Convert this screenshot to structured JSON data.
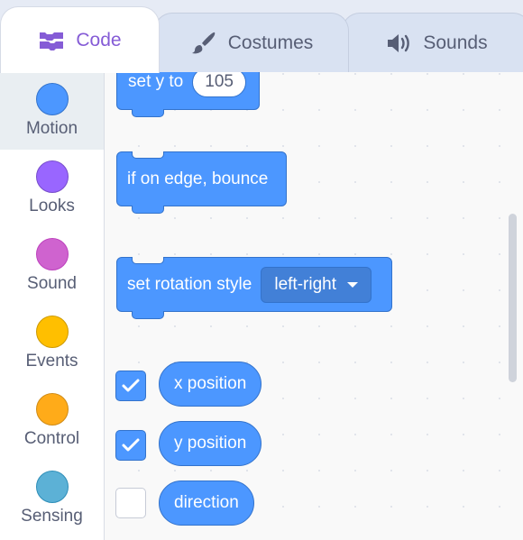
{
  "tabs": {
    "code": "Code",
    "costumes": "Costumes",
    "sounds": "Sounds"
  },
  "categories": [
    {
      "label": "Motion",
      "color": "#4c97ff",
      "border": "#3373cc"
    },
    {
      "label": "Looks",
      "color": "#9966ff",
      "border": "#774dcb"
    },
    {
      "label": "Sound",
      "color": "#cf63cf",
      "border": "#bd42bd"
    },
    {
      "label": "Events",
      "color": "#ffbf00",
      "border": "#cc9900"
    },
    {
      "label": "Control",
      "color": "#ffab19",
      "border": "#cf8b17"
    },
    {
      "label": "Sensing",
      "color": "#5cb1d6",
      "border": "#2e8eb8"
    }
  ],
  "blocks": {
    "set_y": {
      "label": "set y to",
      "value": "105"
    },
    "bounce": {
      "label": "if on edge, bounce"
    },
    "rotation": {
      "label": "set rotation style",
      "option": "left-right"
    }
  },
  "reporters": [
    {
      "label": "x position",
      "checked": true
    },
    {
      "label": "y position",
      "checked": true
    },
    {
      "label": "direction",
      "checked": false
    }
  ],
  "colors": {
    "motion": "#4c97ff",
    "accent": "#855cd6"
  }
}
